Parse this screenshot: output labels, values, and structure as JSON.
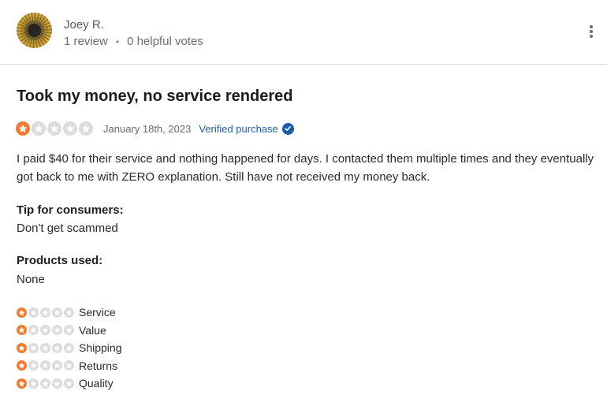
{
  "reviewer": {
    "name": "Joey R.",
    "review_count": "1 review",
    "separator": "•",
    "helpful_votes": "0 helpful votes"
  },
  "review": {
    "title": "Took my money, no service rendered",
    "overall_rating": 1,
    "max_rating": 5,
    "date": "January 18th, 2023",
    "verified_label": "Verified purchase",
    "body": "I paid $40 for their service and nothing happened for days. I contacted them multiple times and they eventually got back to me with ZERO explanation. Still have not received my money back."
  },
  "tip": {
    "label": "Tip for consumers:",
    "value": "Don't get scammed"
  },
  "products": {
    "label": "Products used:",
    "value": "None"
  },
  "category_ratings": [
    {
      "label": "Service",
      "rating": 1
    },
    {
      "label": "Value",
      "rating": 1
    },
    {
      "label": "Shipping",
      "rating": 1
    },
    {
      "label": "Returns",
      "rating": 1
    },
    {
      "label": "Quality",
      "rating": 1
    }
  ],
  "colors": {
    "star_active": "#ef7b32",
    "star_inactive": "#dcdcdc",
    "verified_blue": "#2160a8"
  },
  "icons": {
    "menu": "vertical-ellipsis-icon",
    "star": "star-icon",
    "verified": "check-badge-icon"
  }
}
